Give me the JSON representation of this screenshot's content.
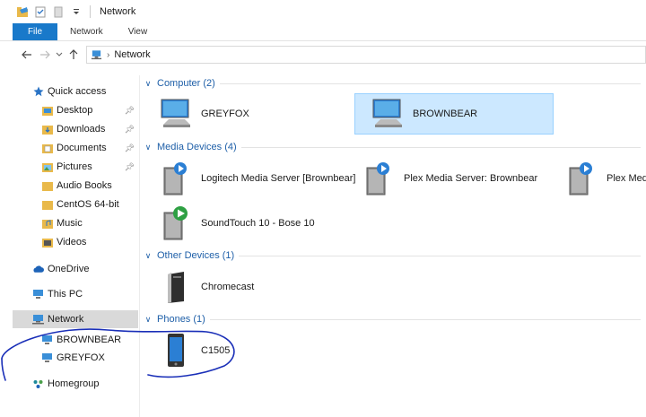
{
  "window": {
    "title": "Network"
  },
  "ribbon": {
    "tabs": [
      {
        "label": "File"
      },
      {
        "label": "Network"
      },
      {
        "label": "View"
      }
    ]
  },
  "address": {
    "crumbs": [
      {
        "label": "Network"
      }
    ]
  },
  "sidebar": {
    "quick_access": "Quick access",
    "items": [
      {
        "label": "Desktop",
        "icon": "desktop-folder-icon",
        "pinned": true
      },
      {
        "label": "Downloads",
        "icon": "downloads-folder-icon",
        "pinned": true
      },
      {
        "label": "Documents",
        "icon": "documents-folder-icon",
        "pinned": true
      },
      {
        "label": "Pictures",
        "icon": "pictures-folder-icon",
        "pinned": true
      },
      {
        "label": "Audio Books",
        "icon": "folder-icon",
        "pinned": false
      },
      {
        "label": "CentOS 64-bit",
        "icon": "folder-icon",
        "pinned": false
      },
      {
        "label": "Music",
        "icon": "music-folder-icon",
        "pinned": false
      },
      {
        "label": "Videos",
        "icon": "videos-folder-icon",
        "pinned": false
      }
    ],
    "onedrive": "OneDrive",
    "this_pc": "This PC",
    "network": "Network",
    "network_children": [
      {
        "label": "BROWNBEAR"
      },
      {
        "label": "GREYFOX"
      }
    ],
    "homegroup": "Homegroup"
  },
  "groups": {
    "computer": {
      "title": "Computer (2)",
      "items": [
        {
          "label": "GREYFOX"
        },
        {
          "label": "BROWNBEAR",
          "selected": true
        }
      ]
    },
    "media": {
      "title": "Media Devices (4)",
      "items": [
        {
          "label": "Logitech Media Server [Brownbear]"
        },
        {
          "label": "Plex Media Server: Brownbear"
        },
        {
          "label": "Plex Media"
        },
        {
          "label": "SoundTouch 10 - Bose 10"
        }
      ]
    },
    "other": {
      "title": "Other Devices (1)",
      "items": [
        {
          "label": "Chromecast"
        }
      ]
    },
    "phones": {
      "title": "Phones (1)",
      "items": [
        {
          "label": "C1505"
        }
      ]
    }
  },
  "colors": {
    "accent": "#1979ca",
    "group_title": "#1e5fa8",
    "selection": "#cce8ff",
    "annotation_ink": "#1a2fb8"
  }
}
